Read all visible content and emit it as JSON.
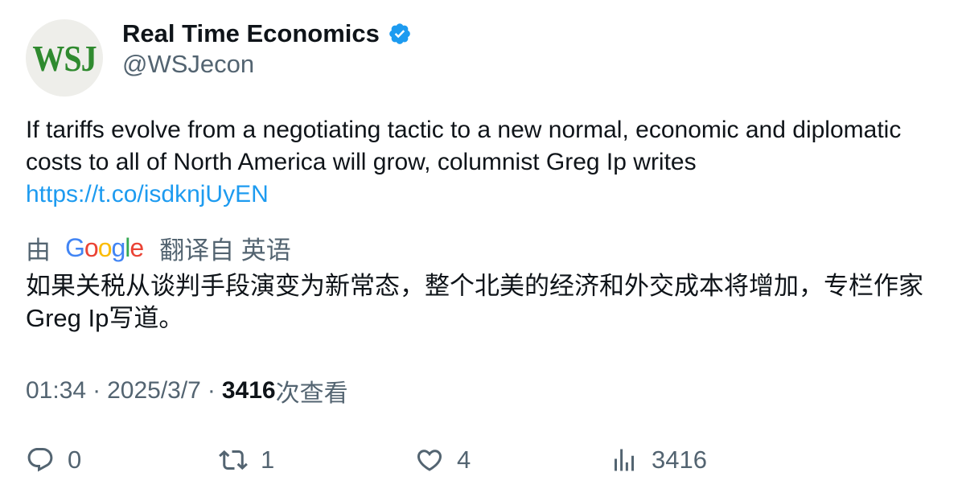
{
  "account": {
    "avatar_text": "WSJ",
    "display_name": "Real Time Economics",
    "handle": "@WSJecon",
    "verified_icon": "verified-badge-icon",
    "verified_color": "#1d9bf0"
  },
  "tweet": {
    "text": "If tariffs evolve from a negotiating tactic to a new normal, economic and diplomatic costs to all of North America will grow, columnist Greg Ip writes",
    "link": "https://t.co/isdknjUyEN"
  },
  "translation": {
    "prefix": "由",
    "provider": "Google",
    "suffix": "翻译自 英语",
    "text": "如果关税从谈判手段演变为新常态，整个北美的经济和外交成本将增加，专栏作家Greg Ip写道。"
  },
  "meta": {
    "time": "01:34",
    "separator": "·",
    "date": "2025/3/7",
    "views_count": "3416",
    "views_label": "次查看"
  },
  "actions": {
    "reply": {
      "icon": "reply-icon",
      "count": "0"
    },
    "retweet": {
      "icon": "retweet-icon",
      "count": "1"
    },
    "like": {
      "icon": "heart-icon",
      "count": "4"
    },
    "views": {
      "icon": "views-chart-icon",
      "count": "3416"
    }
  },
  "colors": {
    "text_primary": "#0f1419",
    "text_secondary": "#536471",
    "link": "#1d9bf0",
    "avatar_bg": "#eeeeea",
    "avatar_text": "#2f8a2f"
  }
}
